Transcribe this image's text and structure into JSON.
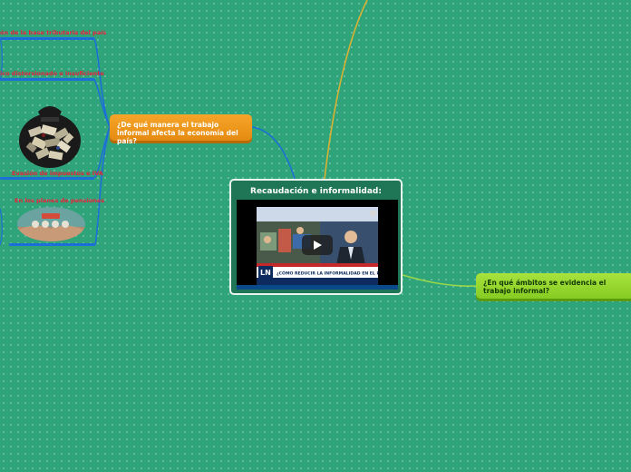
{
  "central": {
    "title": "Recaudación e informalidad:",
    "video": {
      "channel_logo": "LN",
      "headline": "¿CÓMO REDUCIR LA INFORMALIDAD EN EL PAÍS?"
    }
  },
  "topics": {
    "economy": "¿De qué manera el trabajo informal afecta la economía del país?",
    "areas": "¿En qué ámbitos se evidencia el trabajo informal?"
  },
  "subtopics": [
    {
      "label": "ón de la base tributaria del país"
    },
    {
      "label": "ico distorsionado e insuficiente"
    },
    {
      "label": "Evasión de impuestos e IVA"
    },
    {
      "label": "En los planes de pensiones"
    }
  ],
  "colors": {
    "background": "#2fa37a",
    "central_box": "#1e7657",
    "economy_topic": "#f29a1c",
    "areas_topic": "#97d930",
    "subtopic_text": "#e8233a",
    "connector_blue": "#1d6fd8",
    "connector_gold": "#d9b233",
    "connector_green": "#9ad84a"
  }
}
